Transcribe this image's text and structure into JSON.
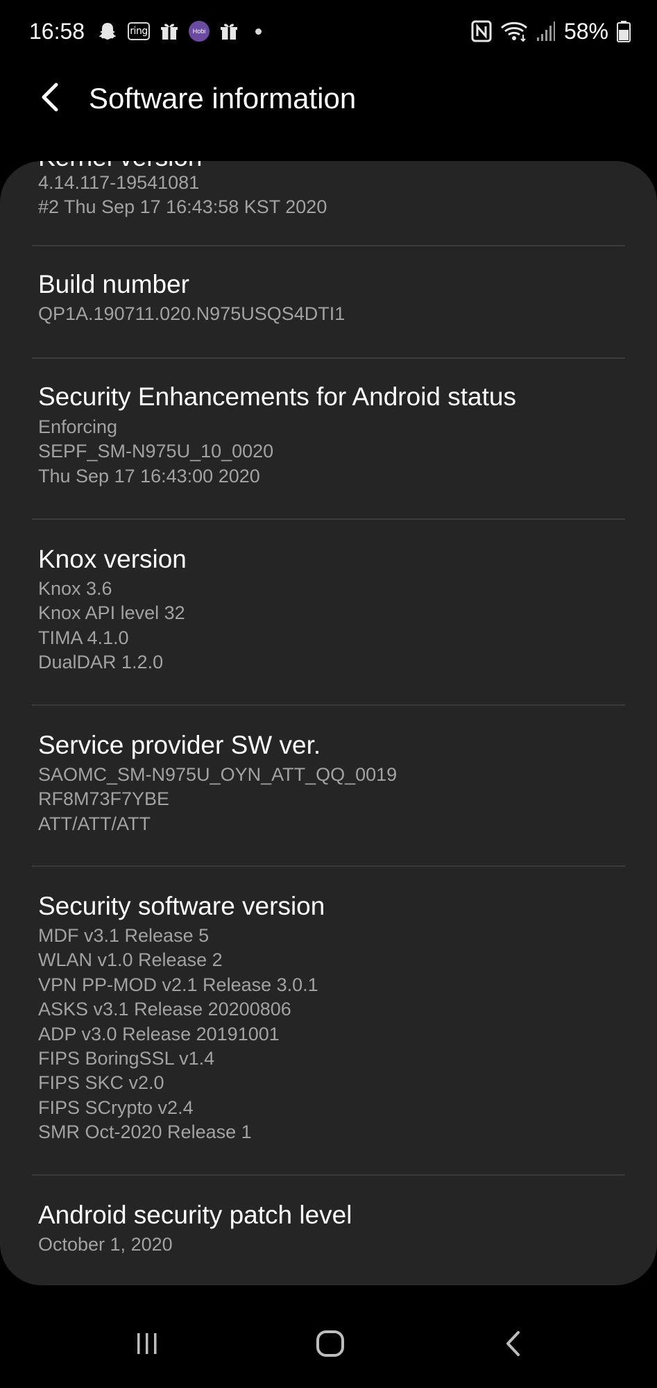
{
  "status_bar": {
    "time": "16:58",
    "left_icons": [
      "snapchat-icon",
      "ring-icon",
      "gift-icon",
      "hobi-icon",
      "gift-icon",
      "dot-icon"
    ],
    "ring_label": "ring",
    "hobi_label": "Hobi",
    "right_icons": [
      "nfc-icon",
      "wifi-icon",
      "signal-icon",
      "battery-icon"
    ],
    "battery_percent": "58%"
  },
  "header": {
    "back_icon": "back-chevron-icon",
    "title": "Software information"
  },
  "card": {
    "cut_off_label": "Kernel version",
    "items": [
      {
        "title": "",
        "values": [
          "4.14.117-19541081",
          "#2 Thu Sep 17 16:43:58 KST 2020"
        ]
      },
      {
        "title": "Build number",
        "values": [
          "QP1A.190711.020.N975USQS4DTI1"
        ]
      },
      {
        "title": "Security Enhancements for Android status",
        "values": [
          "Enforcing",
          "SEPF_SM-N975U_10_0020",
          "Thu Sep 17 16:43:00 2020"
        ]
      },
      {
        "title": "Knox version",
        "values": [
          "Knox 3.6",
          "Knox API level 32",
          "TIMA 4.1.0",
          "DualDAR 1.2.0"
        ]
      },
      {
        "title": "Service provider SW ver.",
        "values": [
          "SAOMC_SM-N975U_OYN_ATT_QQ_0019",
          "RF8M73F7YBE",
          "ATT/ATT/ATT"
        ]
      },
      {
        "title": "Security software version",
        "values": [
          "MDF v3.1 Release 5",
          "WLAN v1.0 Release 2",
          "VPN PP-MOD v2.1 Release 3.0.1",
          "ASKS v3.1 Release 20200806",
          "ADP v3.0 Release 20191001",
          "FIPS BoringSSL v1.4",
          "FIPS SKC v2.0",
          "FIPS SCrypto v2.4",
          "SMR Oct-2020 Release 1"
        ]
      },
      {
        "title": "Android security patch level",
        "values": [
          "October 1, 2020"
        ]
      }
    ]
  },
  "nav_bar": {
    "buttons": [
      "recent-apps-icon",
      "home-icon",
      "back-icon"
    ]
  },
  "colors": {
    "background": "#000000",
    "card": "#252525",
    "title_text": "#ffffff",
    "value_text": "#a2a2a2",
    "divider": "#3b3b3b"
  }
}
